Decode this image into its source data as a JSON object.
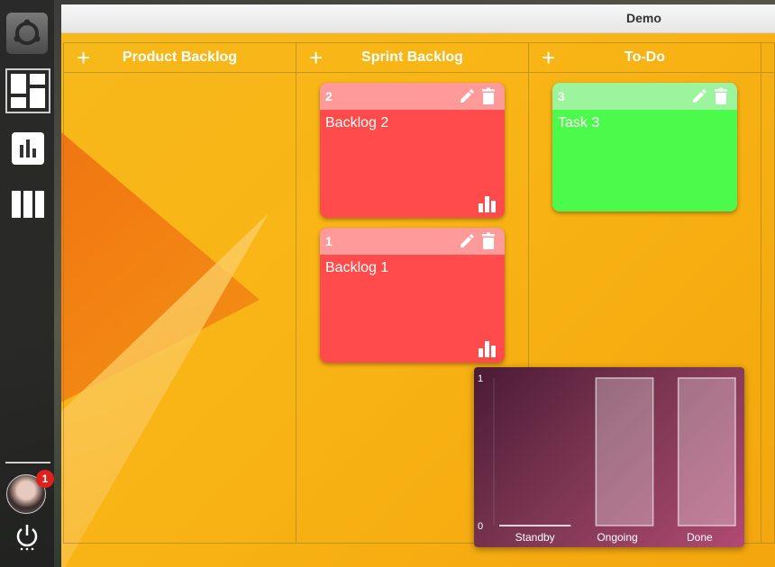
{
  "window": {
    "title": "Demo"
  },
  "sidebar": {
    "items": [
      {
        "name": "ubuntu-launcher"
      },
      {
        "name": "board-view"
      },
      {
        "name": "chart-view"
      },
      {
        "name": "column-view"
      }
    ],
    "notifications": "1"
  },
  "columns": [
    {
      "title": "Product Backlog",
      "add": "+"
    },
    {
      "title": "Sprint Backlog",
      "add": "+"
    },
    {
      "title": "To-Do",
      "add": "+"
    }
  ],
  "cards": [
    {
      "id": "2",
      "title": "Backlog 2",
      "column": "Sprint Backlog",
      "color": "red"
    },
    {
      "id": "1",
      "title": "Backlog 1",
      "column": "Sprint Backlog",
      "color": "red"
    },
    {
      "id": "3",
      "title": "Task 3",
      "column": "To-Do",
      "color": "green"
    }
  ],
  "colors": {
    "board": "#f9b515",
    "card_red": "#ff4b4b",
    "card_green": "#4cfa4c",
    "badge": "#e0201d"
  },
  "chart_data": {
    "type": "bar",
    "categories": [
      "Standby",
      "Ongoing",
      "Done"
    ],
    "values": [
      0,
      1,
      1
    ],
    "ylim": [
      0,
      1
    ],
    "yticks": [
      "0",
      "1"
    ]
  }
}
